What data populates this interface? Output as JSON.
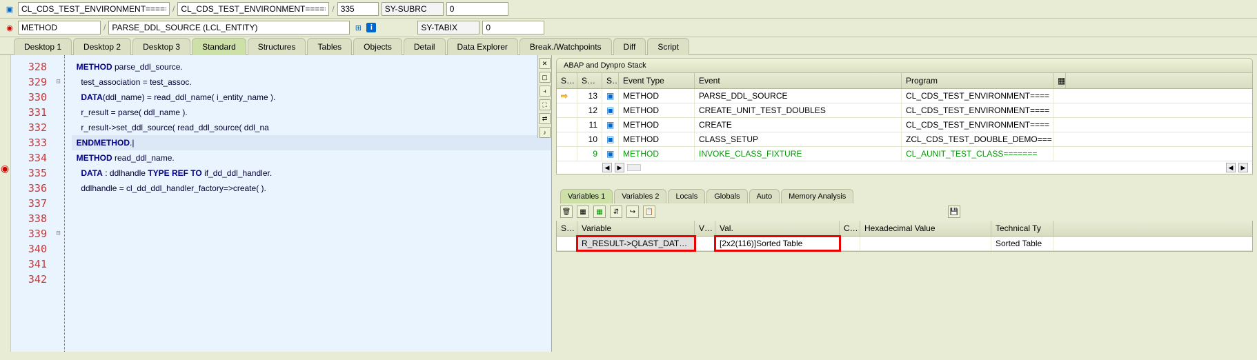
{
  "header1": {
    "prog1": "CL_CDS_TEST_ENVIRONMENT======…",
    "prog2": "CL_CDS_TEST_ENVIRONMENT======…",
    "line": "335",
    "subrc_lbl": "SY-SUBRC",
    "subrc_val": "0"
  },
  "header2": {
    "scope": "METHOD",
    "method": "PARSE_DDL_SOURCE (LCL_ENTITY)",
    "tabix_lbl": "SY-TABIX",
    "tabix_val": "0"
  },
  "tabs": [
    "Desktop 1",
    "Desktop 2",
    "Desktop 3",
    "Standard",
    "Structures",
    "Tables",
    "Objects",
    "Detail",
    "Data Explorer",
    "Break./Watchpoints",
    "Diff",
    "Script"
  ],
  "active_tab": 3,
  "code": {
    "start": 328,
    "lines": [
      "",
      "  METHOD parse_ddl_source.",
      "",
      "    test_association = test_assoc.",
      "",
      "    DATA(ddl_name) = read_ddl_name( i_entity_name ).",
      "    r_result = parse( ddl_name ).",
      "    r_result->set_ddl_source( read_ddl_source( ddl_na",
      "",
      "  ENDMETHOD.",
      "",
      "  METHOD read_ddl_name.",
      "",
      "    DATA : ddlhandle TYPE REF TO if_dd_ddl_handler.",
      "    ddlhandle = cl_dd_ddl_handler_factory=>create( )."
    ],
    "bp_line": 335,
    "cursor_line": 337
  },
  "stack": {
    "title": "ABAP and Dynpro Stack",
    "cols": [
      "St…",
      "Sta…",
      "S..",
      "Event Type",
      "Event",
      "Program"
    ],
    "rows": [
      {
        "cur": true,
        "level": "13",
        "type": "METHOD",
        "event": "PARSE_DDL_SOURCE",
        "prog": "CL_CDS_TEST_ENVIRONMENT===="
      },
      {
        "cur": false,
        "level": "12",
        "type": "METHOD",
        "event": "CREATE_UNIT_TEST_DOUBLES",
        "prog": "CL_CDS_TEST_ENVIRONMENT===="
      },
      {
        "cur": false,
        "level": "11",
        "type": "METHOD",
        "event": "CREATE",
        "prog": "CL_CDS_TEST_ENVIRONMENT===="
      },
      {
        "cur": false,
        "level": "10",
        "type": "METHOD",
        "event": "CLASS_SETUP",
        "prog": "ZCL_CDS_TEST_DOUBLE_DEMO==="
      },
      {
        "cur": false,
        "level": "9",
        "type": "METHOD",
        "event": "INVOKE_CLASS_FIXTURE",
        "prog": "CL_AUNIT_TEST_CLASS=======",
        "hl": true
      }
    ]
  },
  "var_tabs": [
    "Variables 1",
    "Variables 2",
    "Locals",
    "Globals",
    "Auto",
    "Memory Analysis"
  ],
  "var_active": 0,
  "variables": {
    "cols": [
      "S…",
      "Variable",
      "V…",
      "Val.",
      "C…",
      "Hexadecimal Value",
      "Technical Ty"
    ],
    "rows": [
      {
        "name": "R_RESULT->QLAST_DAT…",
        "val": "[2x2(116)]Sorted Table",
        "tech": "Sorted Table"
      }
    ]
  }
}
